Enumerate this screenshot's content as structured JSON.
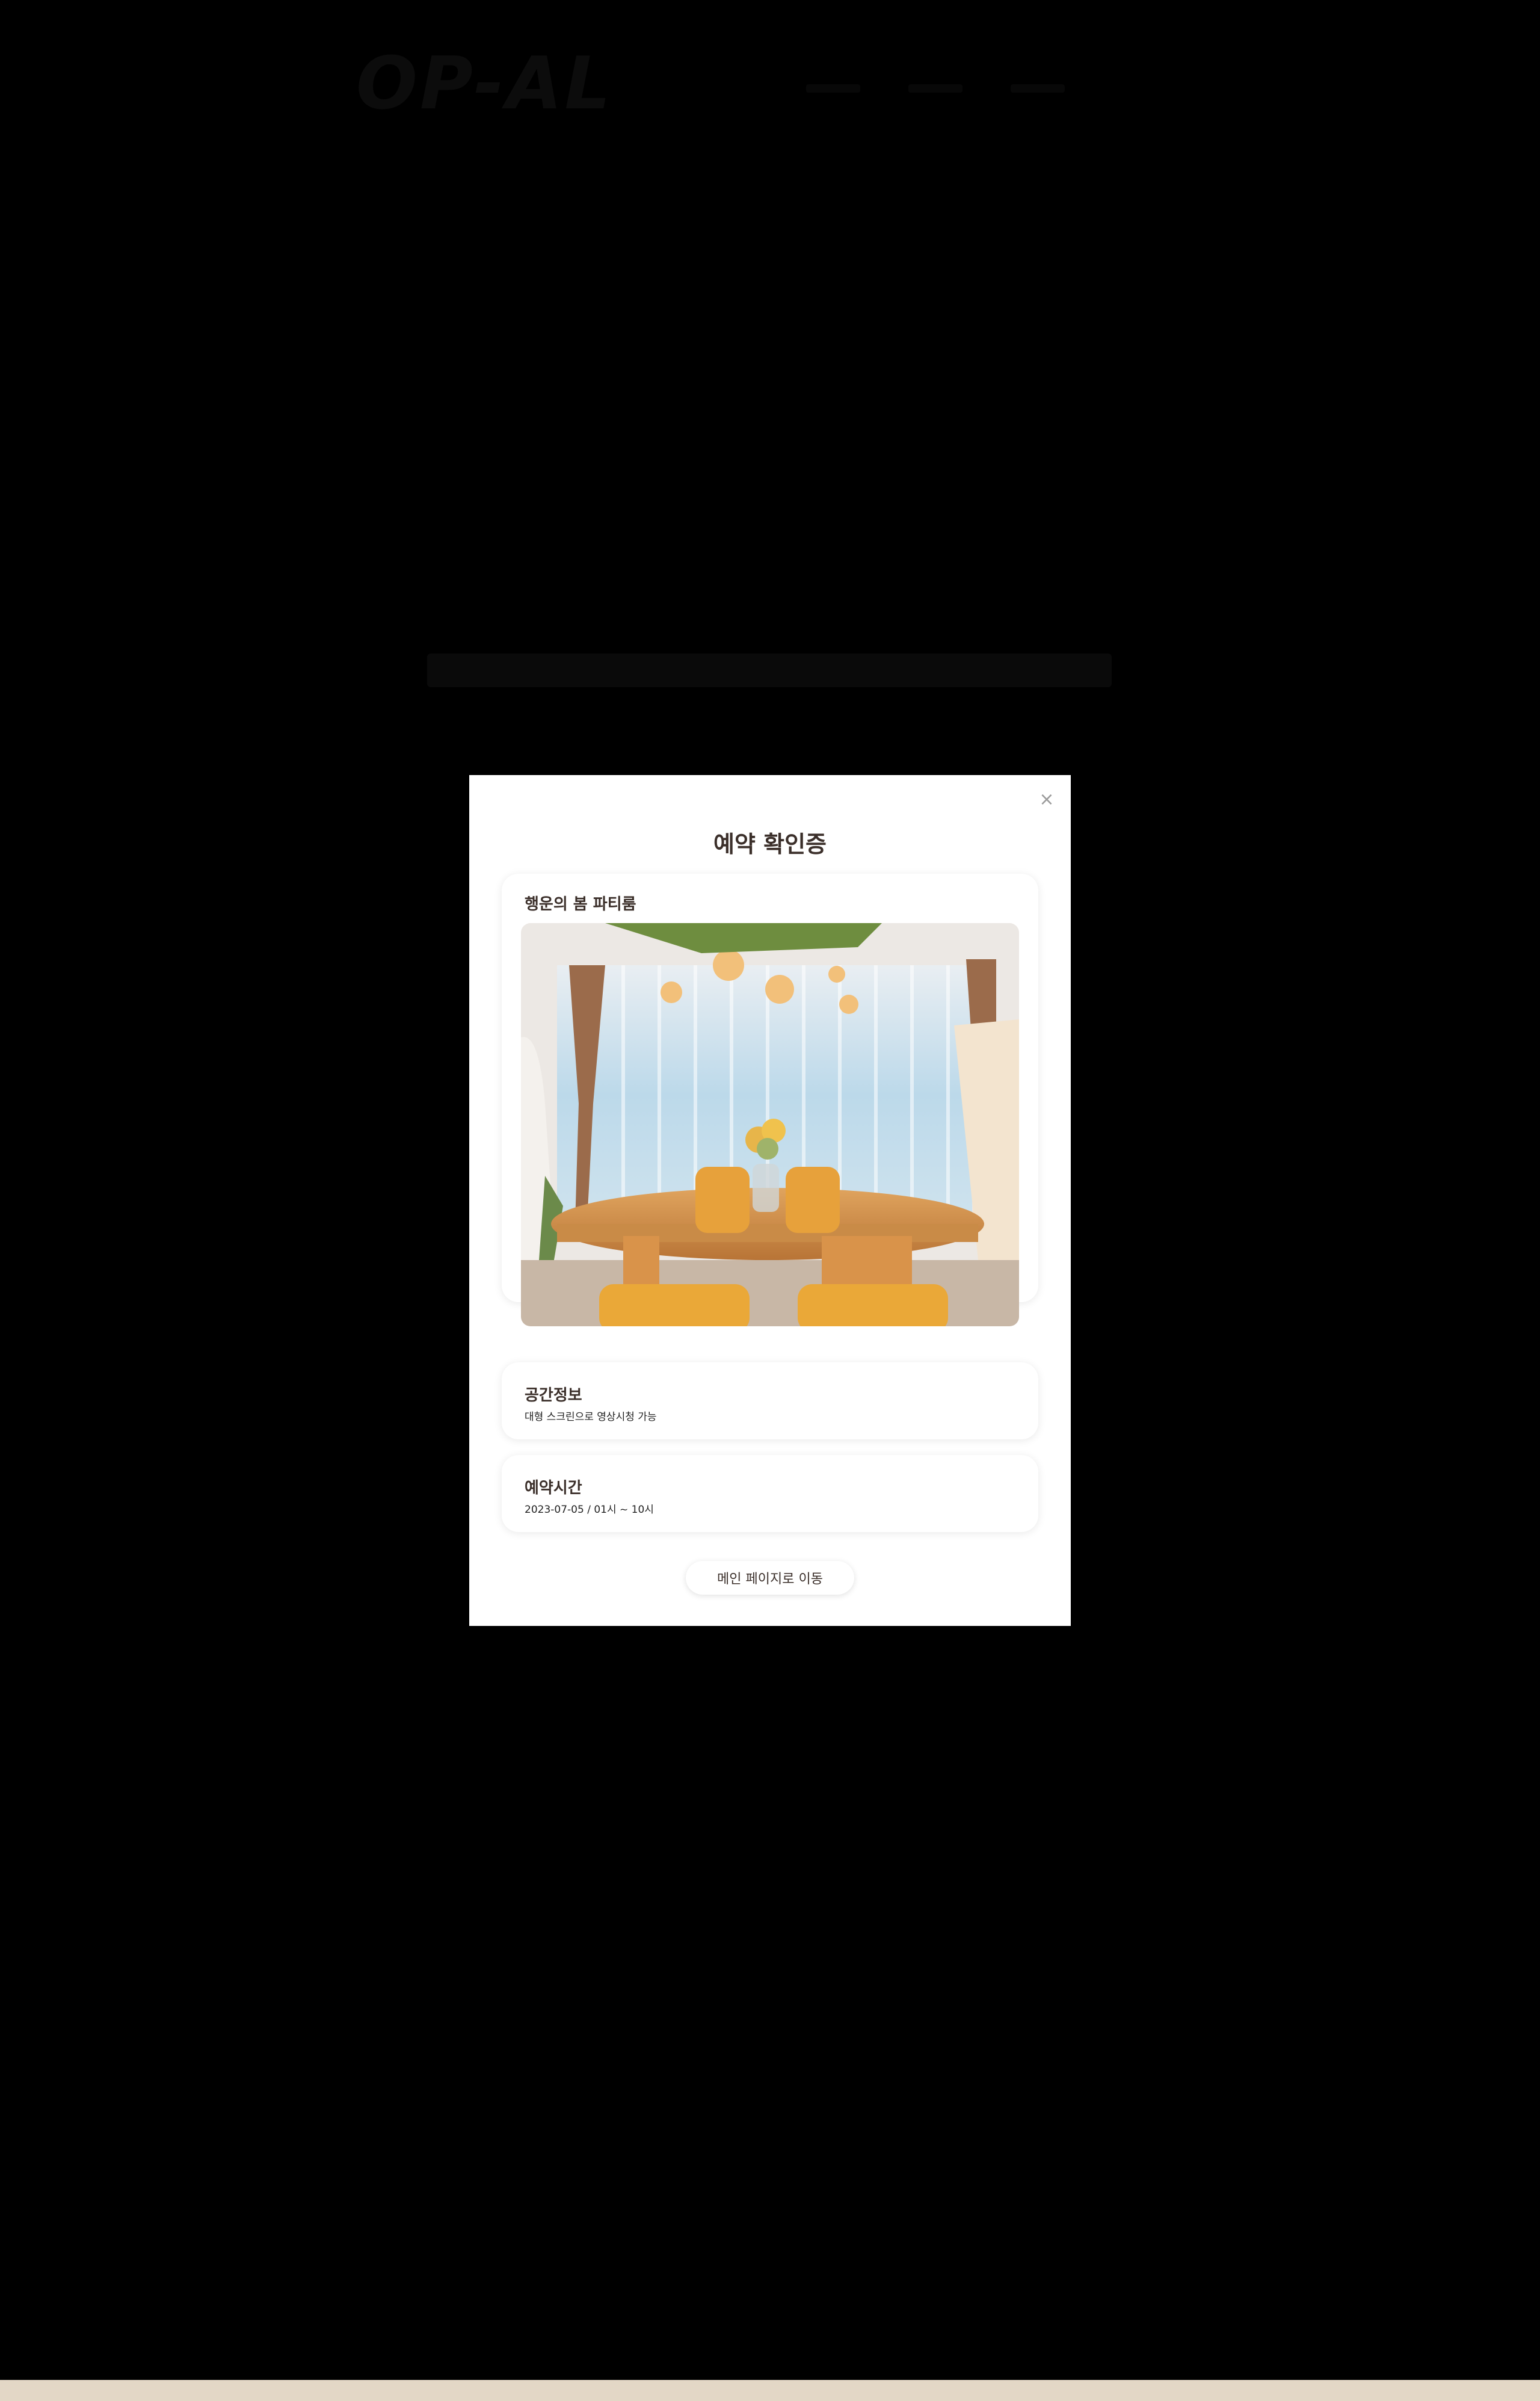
{
  "background_page": {
    "logo_text": "OP-AL"
  },
  "modal": {
    "close_symbol": "×",
    "title": "예약 확인증",
    "room": {
      "name": "행운의 봄 파티룸",
      "photo_icon": "room-photo"
    },
    "space_info": {
      "label": "공간정보",
      "value": "대형 스크린으로 영상시청 가능"
    },
    "reservation_time": {
      "label": "예약시간",
      "value": "2023-07-05 / 01시 ~ 10시"
    },
    "home_button_label": "메인 페이지로 이동"
  },
  "colors": {
    "overlay": "#000000",
    "modal_bg": "#ffffff",
    "text_dark": "#3b2f2a",
    "footer_strip": "#e3d7c6"
  }
}
